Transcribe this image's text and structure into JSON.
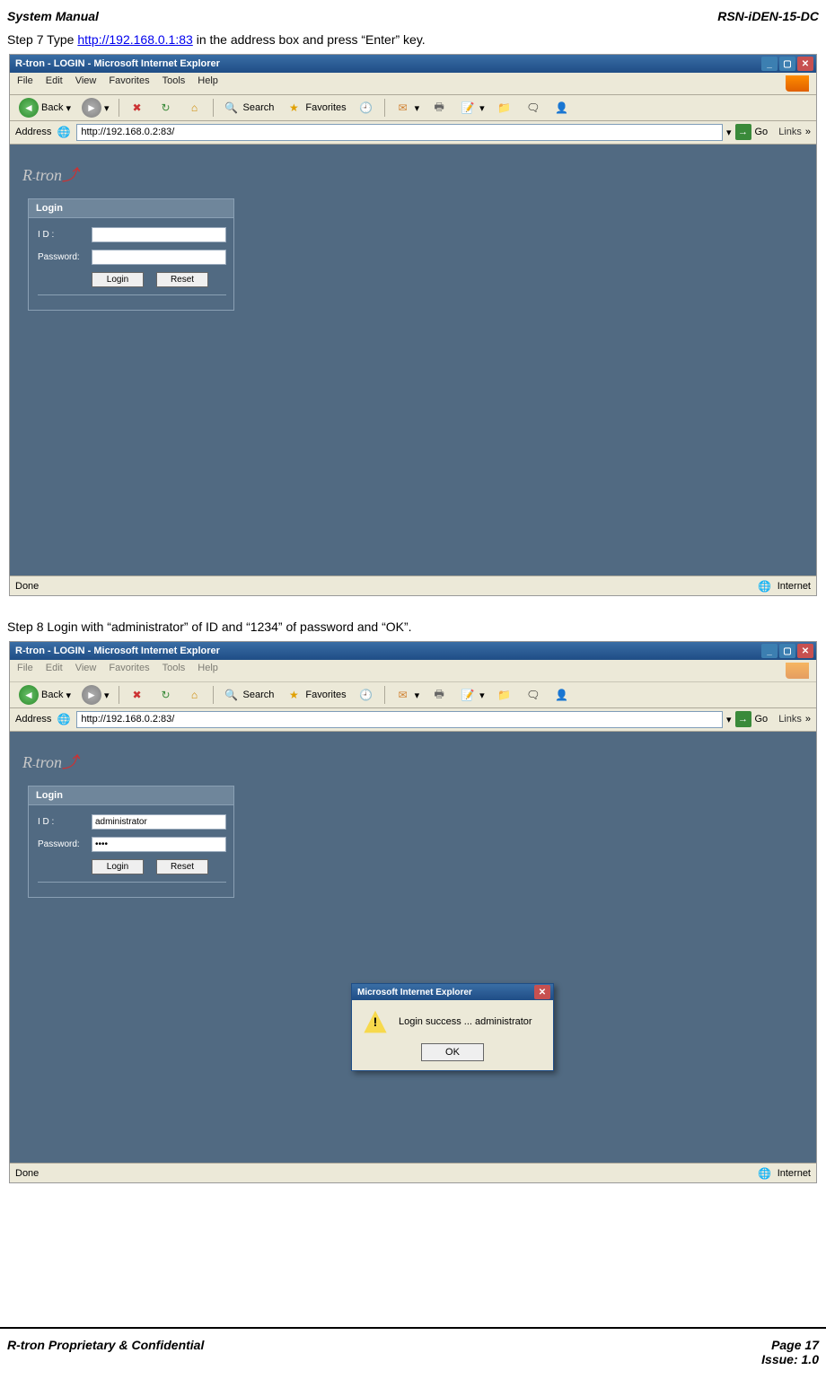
{
  "header": {
    "left": "System Manual",
    "right": "RSN-iDEN-15-DC"
  },
  "step7": {
    "prefix": "Step 7 Type ",
    "url": "http://192.168.0.1:83",
    "suffix": " in the address box and press “Enter” key."
  },
  "step8": {
    "text": "Step 8 Login with “administrator” of ID and “1234” of password and “OK”."
  },
  "window": {
    "title": "R-tron - LOGIN - Microsoft Internet Explorer",
    "menu": {
      "file": "File",
      "edit": "Edit",
      "view": "View",
      "favorites": "Favorites",
      "tools": "Tools",
      "help": "Help"
    },
    "toolbar": {
      "back": "Back",
      "search": "Search",
      "favorites": "Favorites"
    },
    "addressLabel": "Address",
    "addressValue": "http://192.168.0.2:83/",
    "go": "Go",
    "links": "Links",
    "status": {
      "done": "Done",
      "zone": "Internet"
    },
    "login": {
      "heading": "Login",
      "idLabel": "I D :",
      "pwLabel": "Password:",
      "loginBtn": "Login",
      "resetBtn": "Reset"
    }
  },
  "loginValues2": {
    "id": "administrator",
    "pw": "••••"
  },
  "msgbox": {
    "title": "Microsoft Internet Explorer",
    "text": "Login success ... administrator",
    "ok": "OK"
  },
  "footer": {
    "left": "R-tron Proprietary & Confidential",
    "page": "Page 17",
    "issue": "Issue: 1.0"
  }
}
